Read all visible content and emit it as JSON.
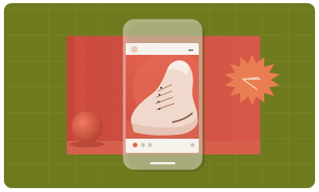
{
  "illustration": {
    "background_color": "#6f7a1f",
    "backdrop_color": "#d9584a",
    "phone_color": "#e3ddcc",
    "starburst_color": "#ea7d52",
    "icons": [
      "avatar-icon",
      "more-options-icon",
      "sneaker-icon",
      "share-arrow-icon",
      "sphere-icon",
      "home-indicator-icon"
    ],
    "post": {
      "carousel_dots": 3,
      "active_dot_index": 0
    },
    "more_options_glyph": "•••"
  }
}
